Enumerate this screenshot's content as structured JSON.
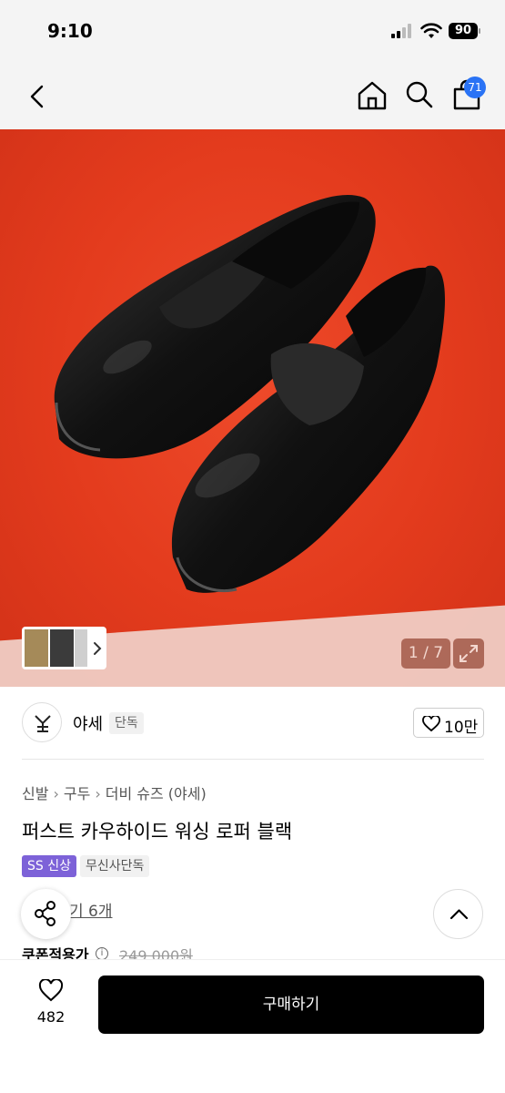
{
  "status_bar": {
    "time": "9:10",
    "battery": "90"
  },
  "nav": {
    "cart_count": "71"
  },
  "gallery": {
    "counter": "1 / 7"
  },
  "brand": {
    "name": "야세",
    "tag": "단독",
    "likes": "10만"
  },
  "product": {
    "breadcrumb": [
      "신발",
      "구두",
      "더비 슈즈 (야세)"
    ],
    "title": "퍼스트 카우하이드 워싱 로퍼 블랙",
    "badges": {
      "season": "SS 신상",
      "exclusive": "무신사단독"
    },
    "review_link": "기 6개",
    "price_label": "쿠폰적용가",
    "original_price": "249,000원"
  },
  "bottom_bar": {
    "wish_count": "482",
    "buy_label": "구매하기"
  },
  "colors": {
    "hero_bg": "#e33b1d",
    "cart_badge": "#2a73f5",
    "ss_badge": "#7d62d8",
    "buy_button": "#000000"
  },
  "icons": [
    "back-icon",
    "home-icon",
    "search-icon",
    "cart-icon",
    "chevron-right-icon",
    "expand-icon",
    "heart-icon",
    "share-icon",
    "chevron-up-icon",
    "info-icon"
  ]
}
